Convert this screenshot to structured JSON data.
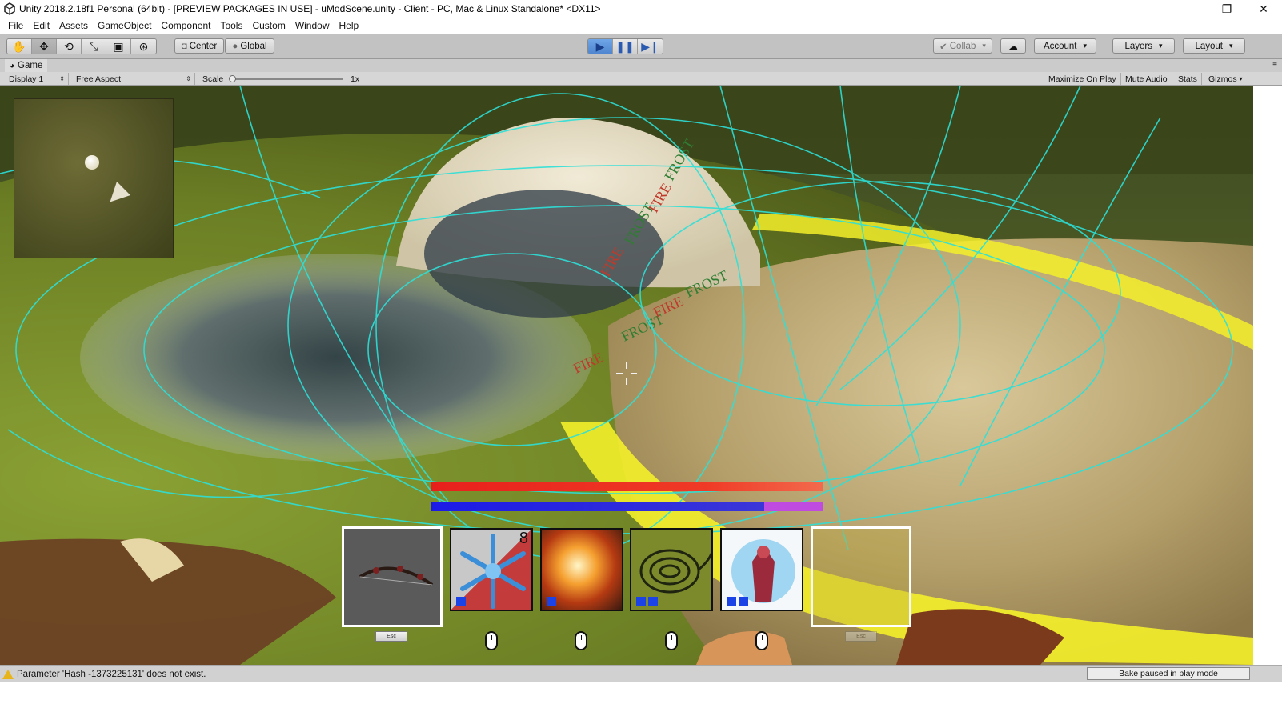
{
  "window": {
    "title": "Unity 2018.2.18f1 Personal (64bit) - [PREVIEW PACKAGES IN USE] - uModScene.unity - Client - PC, Mac & Linux Standalone* <DX11>",
    "controls": [
      "—",
      "❐",
      "✕"
    ]
  },
  "menu": [
    "File",
    "Edit",
    "Assets",
    "GameObject",
    "Component",
    "Tools",
    "Custom",
    "Window",
    "Help"
  ],
  "toolbar": {
    "tools": [
      "hand-tool",
      "move-tool",
      "rotate-tool",
      "scale-tool",
      "rect-tool",
      "transform-tool"
    ],
    "pivot_label": "Center",
    "space_label": "Global",
    "play_controls": [
      "play",
      "pause",
      "step"
    ],
    "collab_label": "Collab",
    "account_label": "Account",
    "layers_label": "Layers",
    "layout_label": "Layout"
  },
  "game_tab": {
    "label": "Game",
    "display": "Display 1",
    "aspect": "Free Aspect",
    "scale_label": "Scale",
    "scale_value": "1x",
    "maximize_label": "Maximize On Play",
    "mute_label": "Mute Audio",
    "stats_label": "Stats",
    "gizmos_label": "Gizmos"
  },
  "scene": {
    "rune_words": [
      "FIRE",
      "FROST",
      "FIRE",
      "FROST",
      "FIRE",
      "FROST",
      "FIRE",
      "FROST"
    ],
    "health_fraction": 1.0,
    "mana_fraction": 0.85
  },
  "hotbar": {
    "slots": [
      {
        "name": "bow",
        "selected": true,
        "key": "Esc"
      },
      {
        "name": "frost-snowflake",
        "count": "8",
        "pips": 1,
        "key": "mouse"
      },
      {
        "name": "fireball",
        "pips": 1,
        "key": "mouse"
      },
      {
        "name": "vine-whip",
        "pips": 2,
        "key": "mouse"
      },
      {
        "name": "frost-mage",
        "pips": 2,
        "key": "mouse"
      },
      {
        "name": "empty",
        "selected": true,
        "key": "Esc"
      }
    ]
  },
  "status": {
    "message": "Parameter 'Hash -1373225131' does not exist.",
    "bake": "Bake paused in play mode"
  },
  "colors": {
    "health": "#e8201c",
    "mana": "#1c1de0",
    "gizmo": "#2de0d8",
    "yellow_glow": "#f4f02a"
  }
}
